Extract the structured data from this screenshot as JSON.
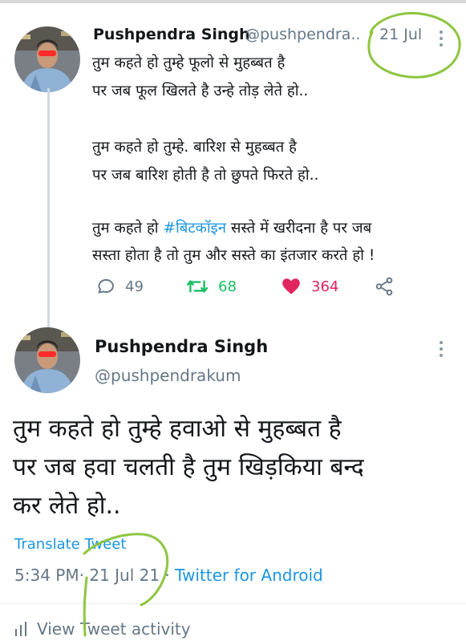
{
  "tweet1": {
    "name": "Pushpendra Singh",
    "handle": "@pushpendra..",
    "separator": "·",
    "date": "21 Jul",
    "lines": [
      "तुम कहते हो तुम्हे फूलो से मुहब्बत है",
      "पर जब फूल खिलते है उन्हे तोड़ लेते हो..",
      "तुम कहते हो  तुम्हे. बारिश से मुहब्बत है",
      "पर जब बारिश होती है तो छुपते फिरते हो..",
      "सस्ता होता है तो तुम और सस्ते का इंतजार करते हो !"
    ],
    "line5_prefix": "तुम कहते हो ",
    "hashtag": "#बिटकॉइन",
    "line5_suffix": " सस्ते में खरीदना है पर जब",
    "replies": "49",
    "retweets": "68",
    "likes": "364"
  },
  "tweet2": {
    "name": "Pushpendra Singh",
    "handle": "@pushpendrakum",
    "lines": [
      "तुम कहते हो तुम्हे हवाओ से मुहब्बत है",
      "पर जब हवा चलती है तुम खिड़किया बन्द",
      "कर लेते हो.."
    ],
    "translate": "Translate Tweet",
    "time": "5:34 PM",
    "separator": "·",
    "date": "21 Jul 21",
    "source": "Twitter for Android",
    "activity": "View Tweet activity"
  },
  "icons": {
    "reply": "reply-icon",
    "retweet": "retweet-icon",
    "like": "heart-icon",
    "share": "share-icon",
    "more": "more-vertical-icon",
    "activity": "bar-chart-icon"
  },
  "colors": {
    "link": "#1b95e0",
    "muted": "#657786",
    "retweet": "#17bf63",
    "like": "#e0245e",
    "annotation": "#8dc63f"
  }
}
